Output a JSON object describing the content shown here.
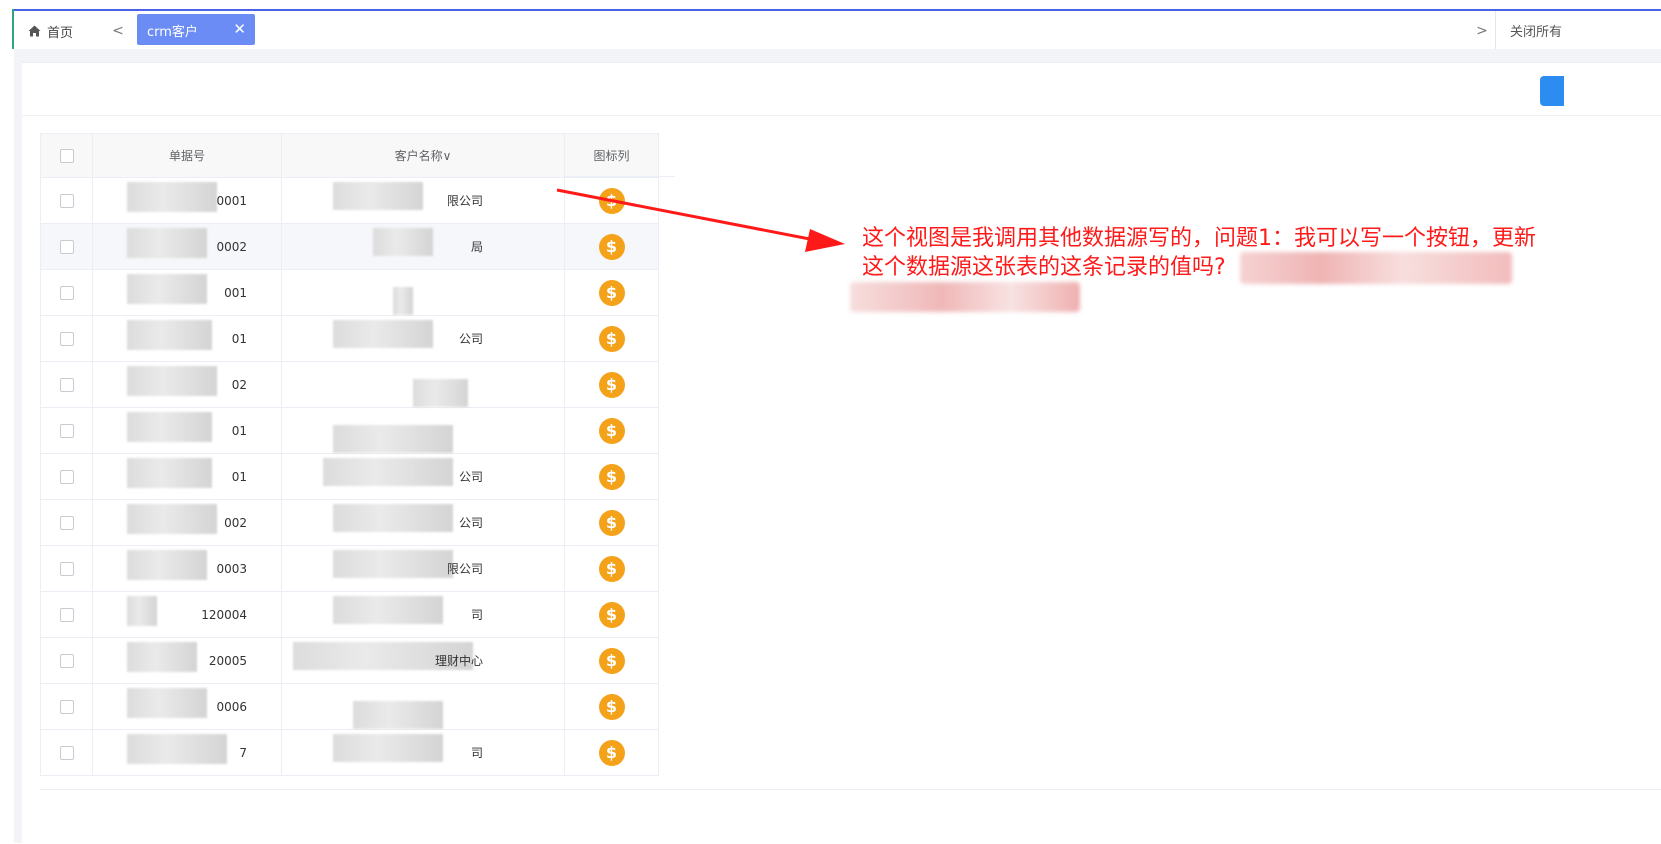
{
  "tabbar": {
    "home_label": "首页",
    "prev_glyph": "<",
    "active_tab_label": "crm客户",
    "active_tab_close": "✕",
    "next_glyph": ">",
    "close_all_label": "关闭所有"
  },
  "table": {
    "columns": [
      "单据号",
      "客户名称",
      "图标列"
    ],
    "sort_glyph": "∨",
    "coin_glyph": "$",
    "rows": [
      {
        "doc_no": "0001",
        "customer": "限公司"
      },
      {
        "doc_no": "0002",
        "customer": "局"
      },
      {
        "doc_no": "001",
        "customer": ""
      },
      {
        "doc_no": "01",
        "customer": "公司"
      },
      {
        "doc_no": "02",
        "customer": ""
      },
      {
        "doc_no": "01",
        "customer": ""
      },
      {
        "doc_no": "01",
        "customer": "公司"
      },
      {
        "doc_no": "002",
        "customer": "公司"
      },
      {
        "doc_no": "0003",
        "customer": "限公司"
      },
      {
        "doc_no": "120004",
        "customer": "司"
      },
      {
        "doc_no": "20005",
        "customer": "理财中心"
      },
      {
        "doc_no": "0006",
        "customer": ""
      },
      {
        "doc_no": "7",
        "customer": "司"
      }
    ]
  },
  "annotation": {
    "line1": "这个视图是我调用其他数据源写的，问题1：我可以写一个按钮，更新",
    "line2": "这个数据源这张表的这条记录的值吗?"
  },
  "colors": {
    "tab_active": "#6a8cf4",
    "coin": "#f5a21b",
    "annotation": "#ff1a1a",
    "primary_button": "#2d8cf0"
  }
}
